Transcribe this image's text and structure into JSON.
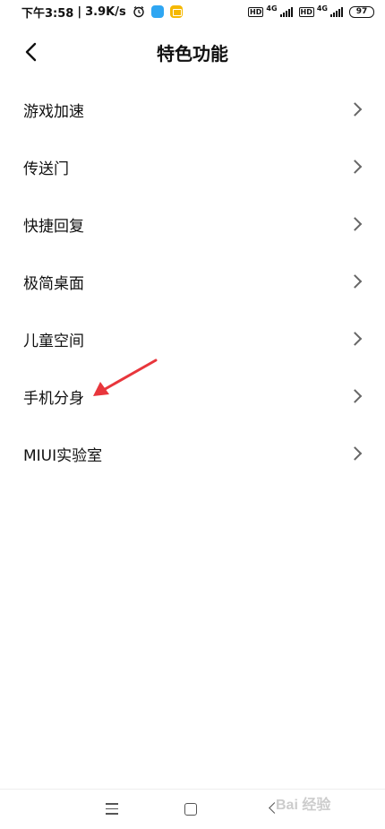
{
  "status_bar": {
    "time": "下午3:58",
    "separator": "|",
    "speed": "3.9K/s",
    "hd1": "HD",
    "net1": "4G",
    "hd2": "HD",
    "net2": "4G",
    "battery": "97"
  },
  "header": {
    "title": "特色功能"
  },
  "menu": {
    "items": [
      {
        "label": "游戏加速"
      },
      {
        "label": "传送门"
      },
      {
        "label": "快捷回复"
      },
      {
        "label": "极简桌面"
      },
      {
        "label": "儿童空间"
      },
      {
        "label": "手机分身"
      },
      {
        "label": "MIUI实验室"
      }
    ]
  },
  "annotation": {
    "color": "#e8363c",
    "points_to": "手机分身"
  },
  "watermark": {
    "text": "Bai 经验"
  }
}
